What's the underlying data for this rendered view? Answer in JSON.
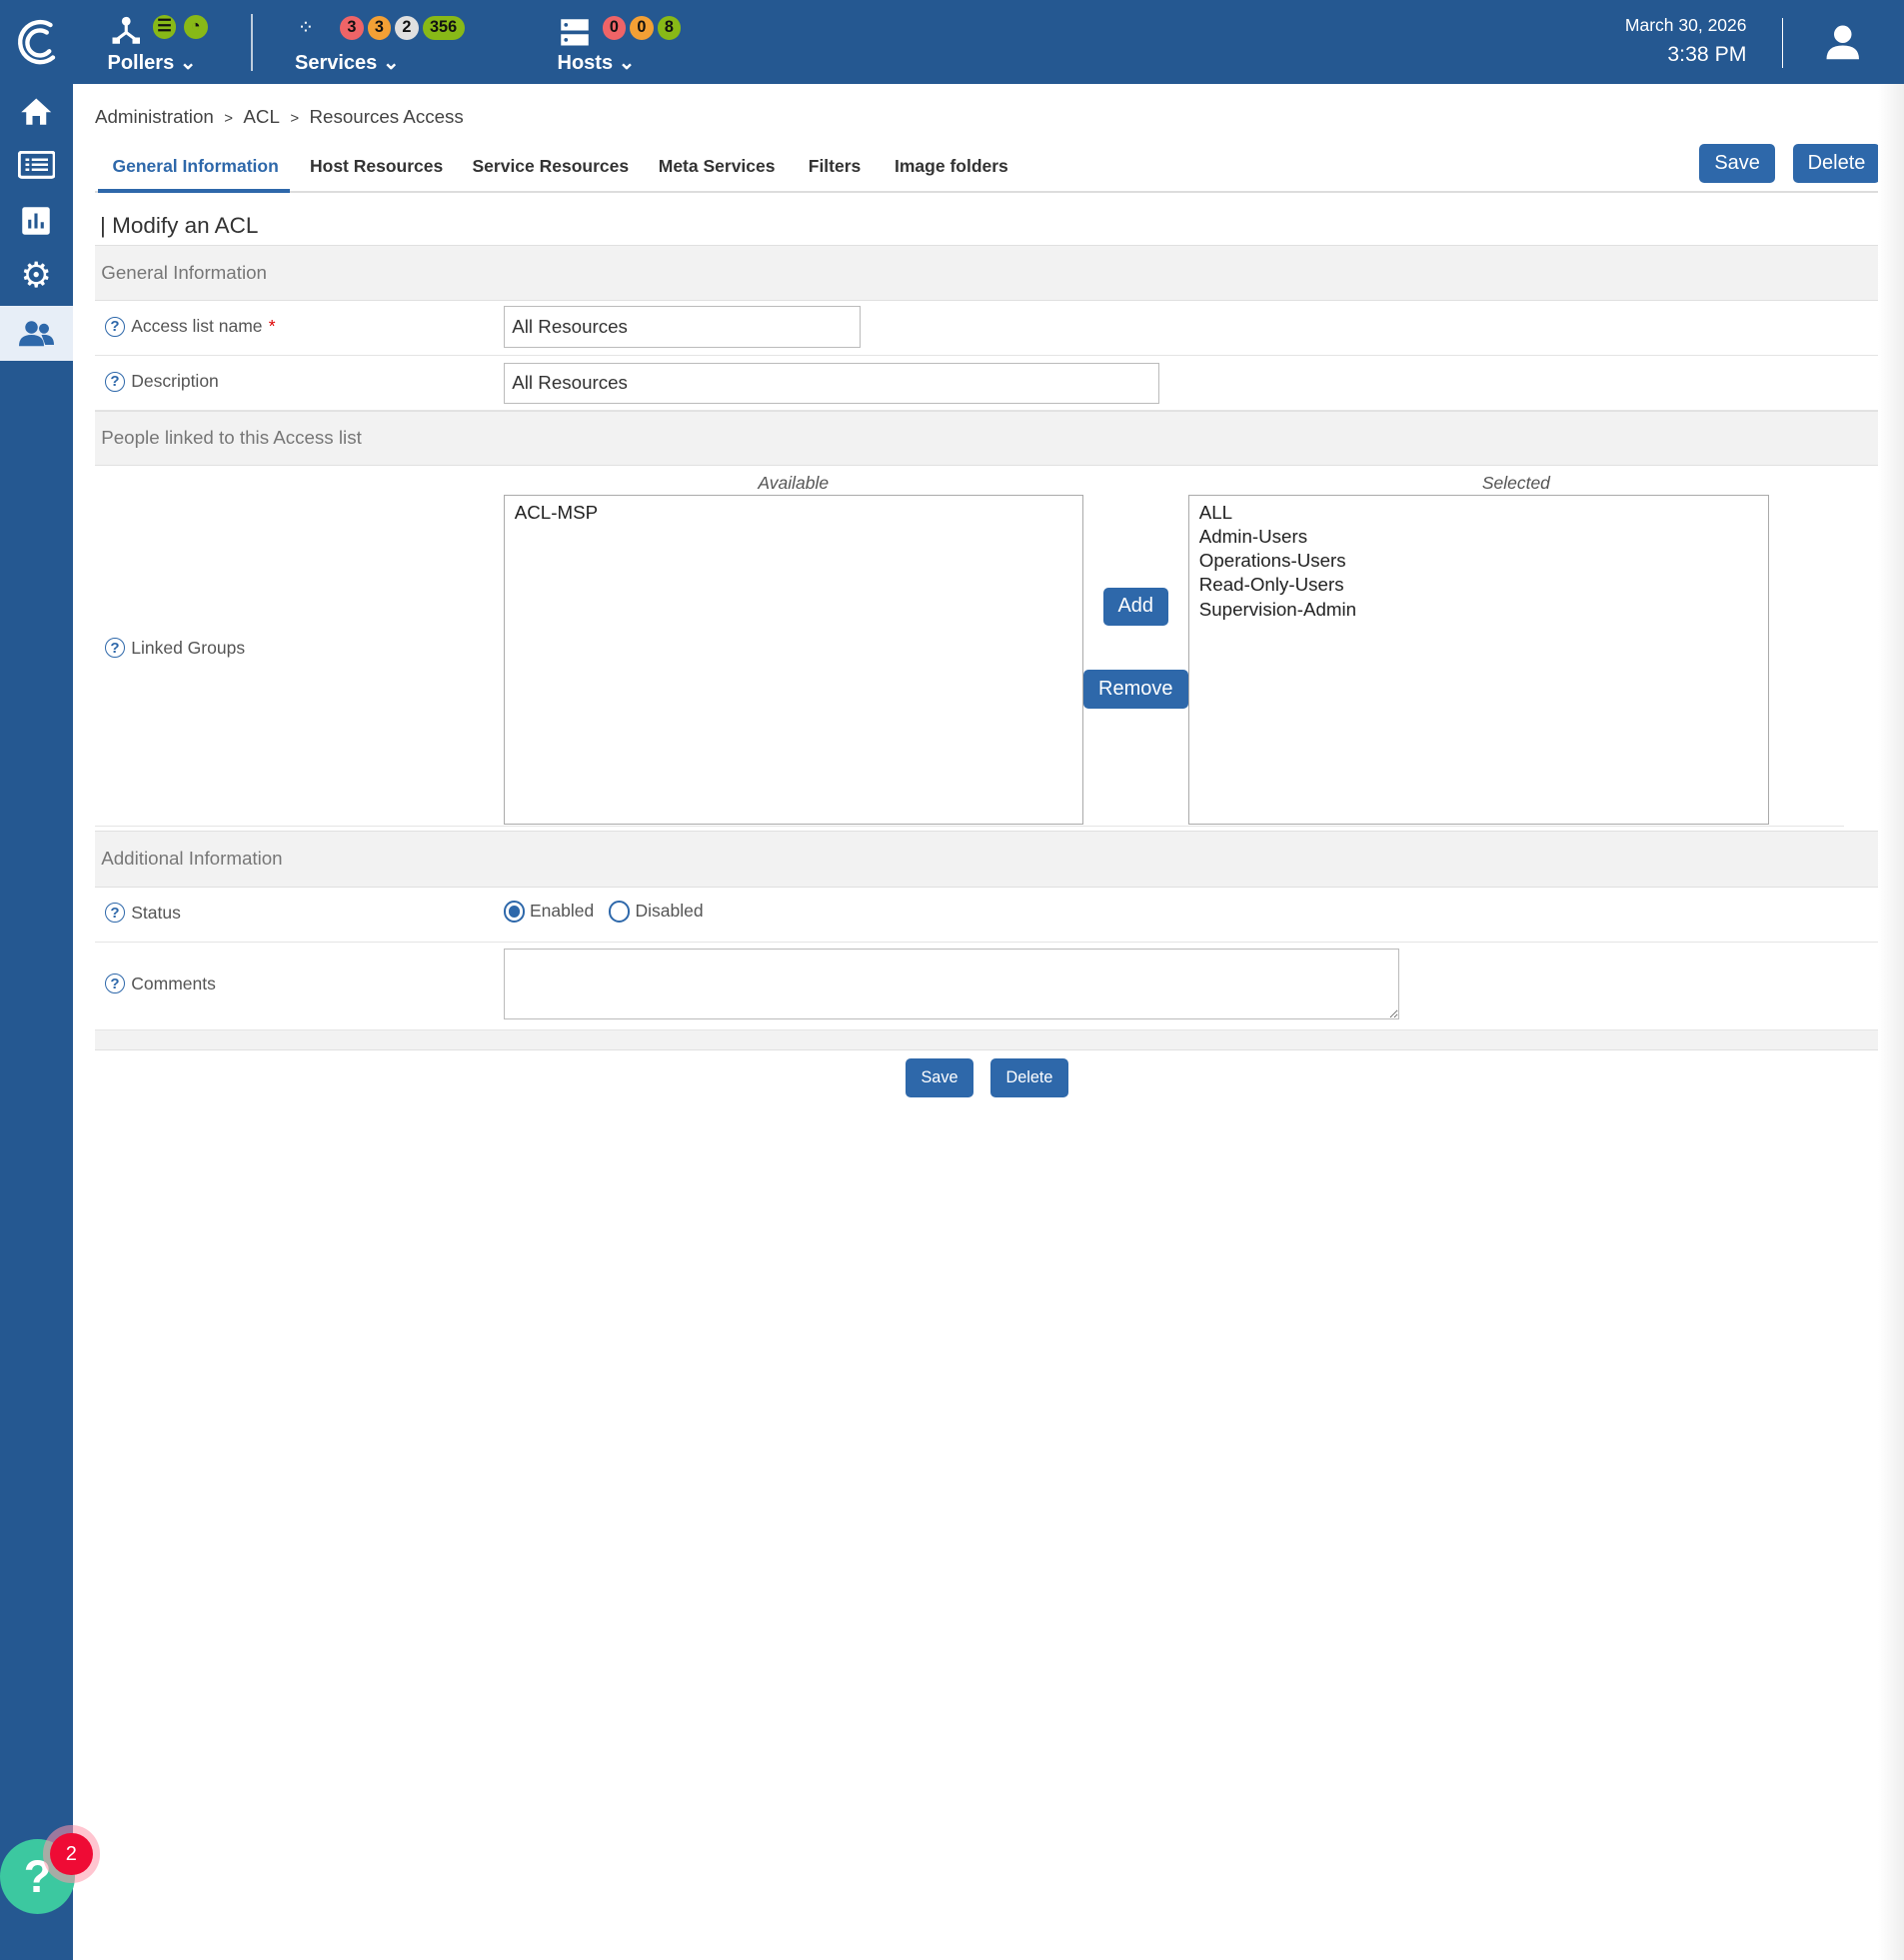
{
  "topbar": {
    "pollers": {
      "label": "Pollers"
    },
    "services": {
      "label": "Services",
      "badges": [
        "3",
        "3",
        "2",
        "356"
      ]
    },
    "hosts": {
      "label": "Hosts",
      "badges": [
        "0",
        "0",
        "8"
      ]
    },
    "date": "March 30, 2026",
    "time": "3:38 PM"
  },
  "colors": {
    "brand": "#255891",
    "button": "#2e68aa",
    "critical": "#ef6467",
    "warning": "#f3a035",
    "unknown": "#e0e0e0",
    "ok": "#88b917"
  },
  "breadcrumb": [
    "Administration",
    ">",
    "ACL",
    ">",
    "Resources Access"
  ],
  "tabs": [
    "General Information",
    "Host Resources",
    "Service Resources",
    "Meta Services",
    "Filters",
    "Image folders"
  ],
  "actions": {
    "save": "Save",
    "delete": "Delete"
  },
  "form": {
    "title": "| Modify an ACL",
    "sections": {
      "general": "General Information",
      "people": "People linked to this Access list",
      "additional": "Additional Information"
    },
    "access_list_name": {
      "label": "Access list name",
      "required": "*",
      "value": "All Resources"
    },
    "description": {
      "label": "Description",
      "value": "All Resources"
    },
    "linked_groups": {
      "label": "Linked Groups",
      "available_header": "Available",
      "selected_header": "Selected",
      "available": [
        "ACL-MSP"
      ],
      "selected": [
        "ALL",
        "Admin-Users",
        "Operations-Users",
        "Read-Only-Users",
        "Supervision-Admin"
      ],
      "add": "Add",
      "remove": "Remove"
    },
    "status": {
      "label": "Status",
      "options": [
        "Enabled",
        "Disabled"
      ],
      "selected": "Enabled"
    },
    "comments": {
      "label": "Comments",
      "value": ""
    }
  },
  "help_widget": {
    "badge": "2",
    "icon": "?"
  }
}
